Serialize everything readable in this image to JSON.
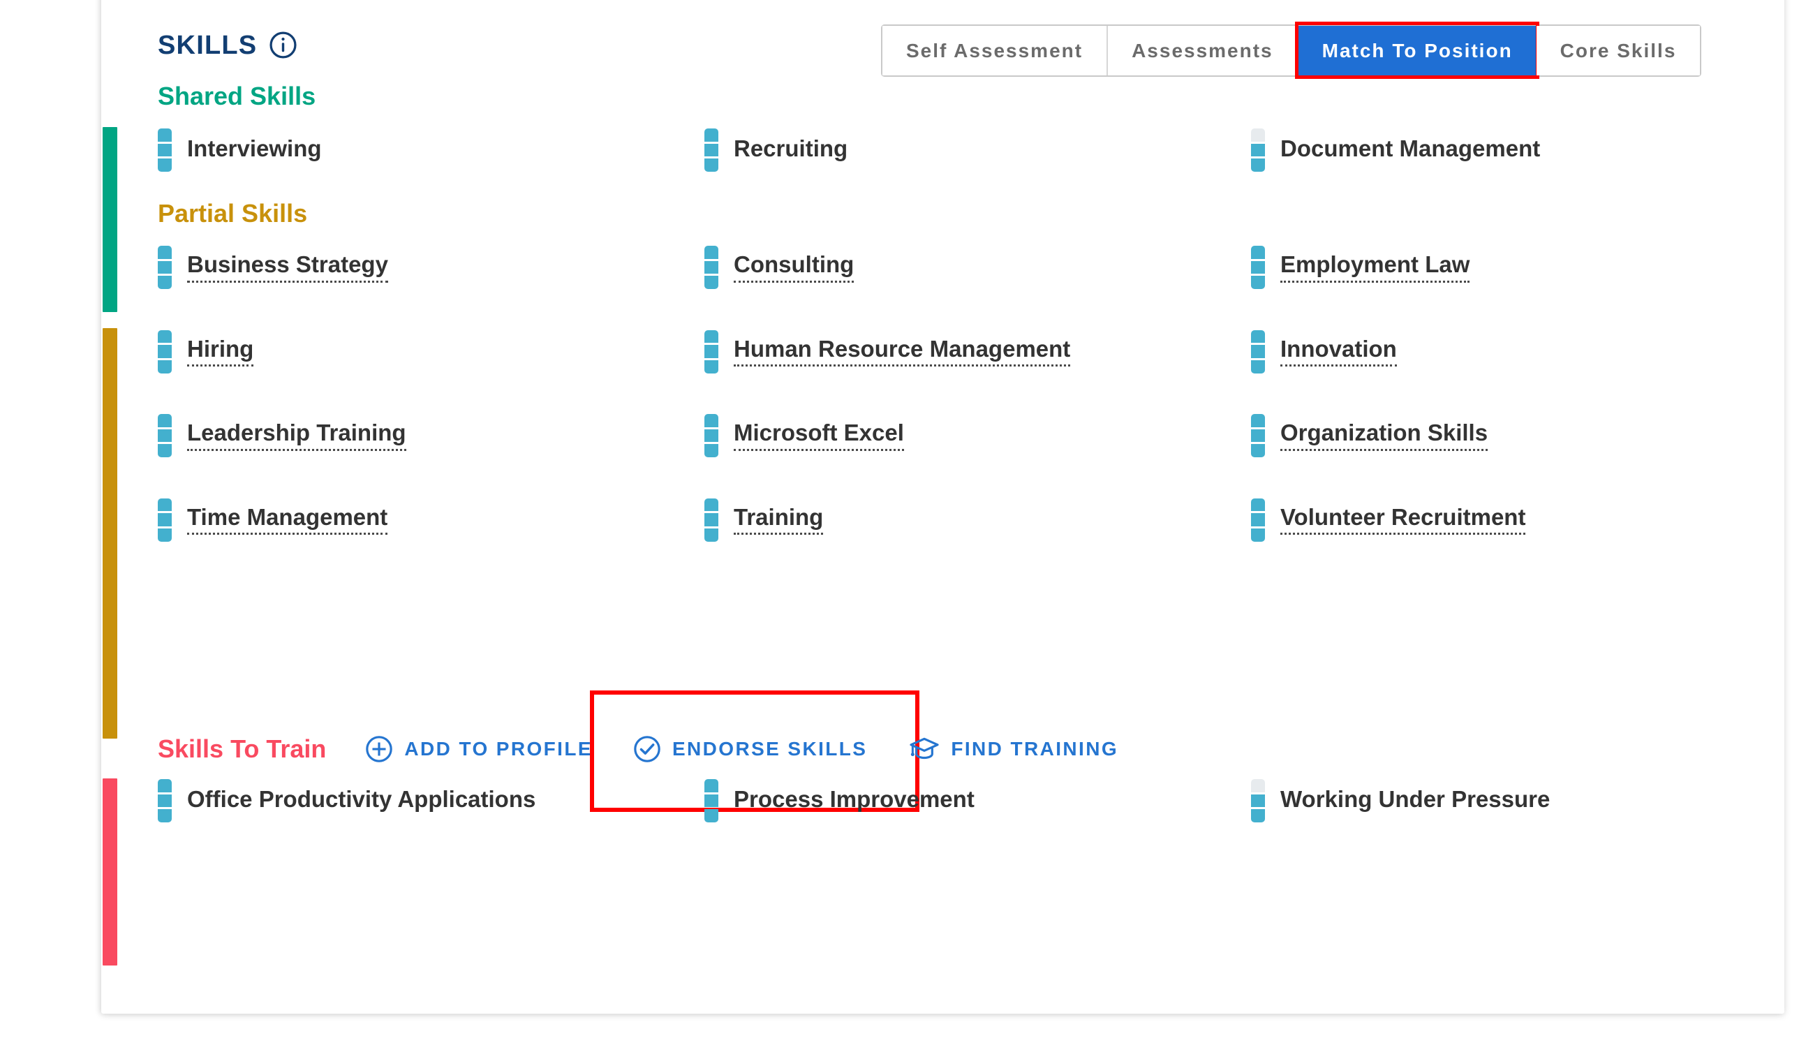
{
  "header": {
    "title": "SKILLS",
    "info_icon": "info-icon"
  },
  "tabs": [
    {
      "label": "Self Assessment",
      "active": false
    },
    {
      "label": "Assessments",
      "active": false
    },
    {
      "label": "Match To Position",
      "active": true
    },
    {
      "label": "Core Skills",
      "active": false
    }
  ],
  "colors": {
    "shared_accent": "#00A583",
    "partial_accent": "#C8910B",
    "train_accent": "#F94A60",
    "active_tab_bg": "#1F6FD4",
    "link_blue": "#2575D0",
    "title_navy": "#123E72",
    "skill_bar": "#43B0CE",
    "skill_bar_off": "#E7EBEE",
    "highlight_red": "#FF0000"
  },
  "sections": [
    {
      "id": "shared-skills",
      "title": "Shared Skills",
      "color": "#00A583",
      "actions": [],
      "skills": [
        {
          "name": "Interviewing",
          "level": 3,
          "dotted": false
        },
        {
          "name": "Recruiting",
          "level": 3,
          "dotted": false
        },
        {
          "name": "Document Management",
          "level": 2,
          "dotted": false
        }
      ]
    },
    {
      "id": "partial-skills",
      "title": "Partial Skills",
      "color": "#C8910B",
      "actions": [],
      "skills": [
        {
          "name": "Business Strategy",
          "level": 3,
          "dotted": true
        },
        {
          "name": "Consulting",
          "level": 3,
          "dotted": true
        },
        {
          "name": "Employment Law",
          "level": 3,
          "dotted": true
        },
        {
          "name": "Hiring",
          "level": 3,
          "dotted": true
        },
        {
          "name": "Human Resource Management",
          "level": 3,
          "dotted": true
        },
        {
          "name": "Innovation",
          "level": 3,
          "dotted": true
        },
        {
          "name": "Leadership Training",
          "level": 3,
          "dotted": true
        },
        {
          "name": "Microsoft Excel",
          "level": 3,
          "dotted": true
        },
        {
          "name": "Organization Skills",
          "level": 3,
          "dotted": true
        },
        {
          "name": "Time Management",
          "level": 3,
          "dotted": true
        },
        {
          "name": "Training",
          "level": 3,
          "dotted": true
        },
        {
          "name": "Volunteer Recruitment",
          "level": 3,
          "dotted": true
        }
      ]
    },
    {
      "id": "skills-to-train",
      "title": "Skills To Train",
      "color": "#F94A60",
      "actions": [
        {
          "label": "ADD TO PROFILE",
          "icon": "plus-circle-icon",
          "highlighted": false
        },
        {
          "label": "ENDORSE SKILLS",
          "icon": "check-circle-icon",
          "highlighted": true
        },
        {
          "label": "FIND TRAINING",
          "icon": "graduation-cap-icon",
          "highlighted": false
        }
      ],
      "skills": [
        {
          "name": "Office Productivity Applications",
          "level": 3,
          "dotted": false
        },
        {
          "name": "Process Improvement",
          "level": 3,
          "dotted": false
        },
        {
          "name": "Working Under Pressure",
          "level": 2,
          "dotted": false
        }
      ]
    }
  ]
}
